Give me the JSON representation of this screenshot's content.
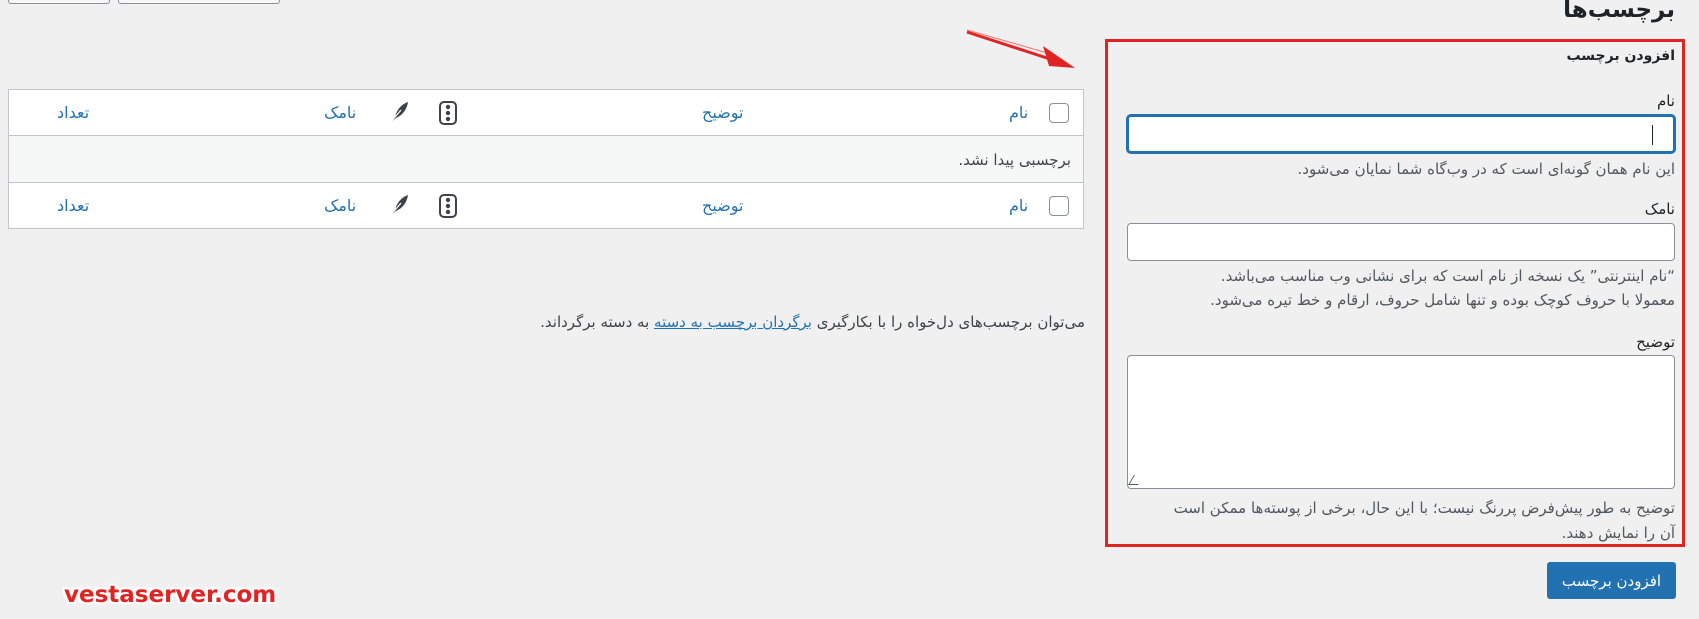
{
  "page": {
    "title": "برچسب‌ها"
  },
  "form": {
    "title": "افزودن برچسب",
    "name_label": "نام",
    "name_value": "",
    "name_help": "این نام همان گونه‌ای است که در وب‌گاه شما نمایان می‌شود.",
    "slug_label": "نامک",
    "slug_value": "",
    "slug_help_1": "“نام اینترنتی” یک نسخه از نام است که برای نشانی وب مناسب می‌باشد.",
    "slug_help_2": "معمولا با حروف کوچک بوده و تنها شامل حروف، ارقام و خط تیره می‌شود.",
    "desc_label": "توضیح",
    "desc_value": "",
    "desc_help_1": "توضیح به طور پیش‌فرض پررنگ نیست؛ با این حال، برخی از پوسته‌ها ممکن است",
    "desc_help_2": "آن را نمایش دهند.",
    "submit_label": "افزودن برچسب"
  },
  "table": {
    "columns": {
      "name": "نام",
      "description": "توضیح",
      "slug": "نامک",
      "count": "تعداد"
    },
    "icons": [
      "comments-icon",
      "feather-icon"
    ],
    "empty_message": "برچسبی پیدا نشد."
  },
  "convert_note": {
    "prefix": "می‌توان برچسب‌های دل‌خواه را با بکارگیری",
    "link": "برگردان برچسب به دسته",
    "suffix": "به دسته برگرداند."
  },
  "watermark": "vestaserver.com",
  "colors": {
    "accent": "#2271b1",
    "annotation": "#e02424",
    "background": "#f0f0f1"
  }
}
